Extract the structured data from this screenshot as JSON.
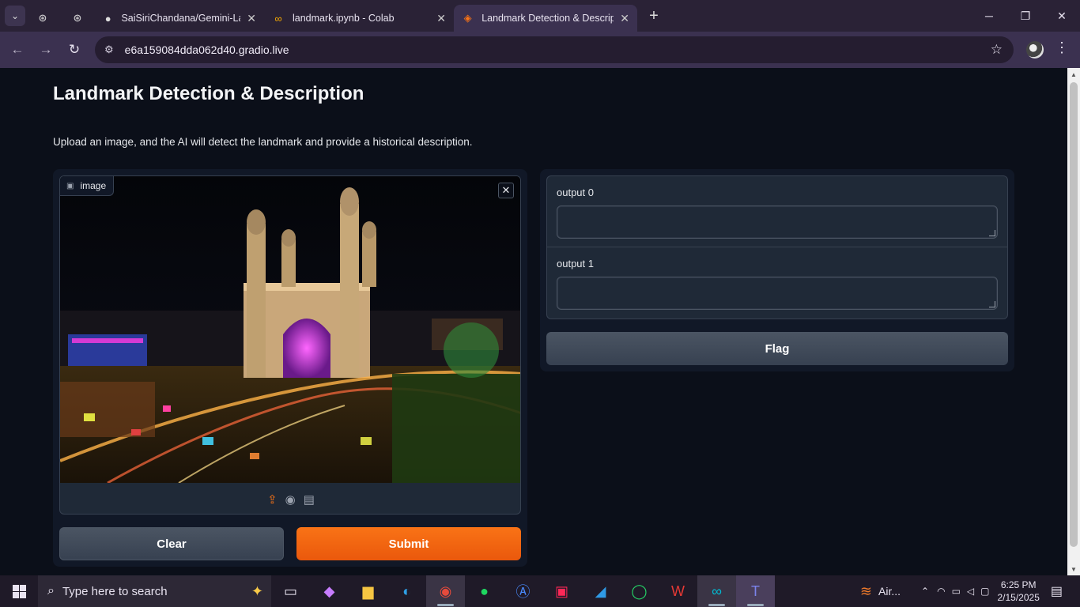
{
  "browser": {
    "tabs": [
      {
        "title": "",
        "icon": "chatgpt-icon",
        "pinned": true
      },
      {
        "title": "",
        "icon": "chatgpt-icon",
        "pinned": true
      },
      {
        "title": "SaiSiriChandana/Gemini-Landm",
        "icon": "github-icon"
      },
      {
        "title": "landmark.ipynb - Colab",
        "icon": "colab-icon"
      },
      {
        "title": "Landmark Detection & Descripti",
        "icon": "gradio-icon",
        "active": true
      }
    ],
    "url": "e6a159084dda062d40.gradio.live"
  },
  "page": {
    "title": "Landmark Detection & Description",
    "description": "Upload an image, and the AI will detect the landmark and provide a historical description.",
    "image_input": {
      "label": "image",
      "picture": "Charminar monument lit up at night above a busy market with light trails"
    },
    "buttons": {
      "clear": "Clear",
      "submit": "Submit",
      "flag": "Flag"
    },
    "outputs": [
      {
        "label": "output 0",
        "value": ""
      },
      {
        "label": "output 1",
        "value": ""
      }
    ]
  },
  "taskbar": {
    "search_placeholder": "Type here to search",
    "weather": "Air...",
    "time": "6:25 PM",
    "date": "2/15/2025"
  },
  "colors": {
    "accent": "#f97316",
    "page_bg": "#0b0f19",
    "panel_bg": "#111827",
    "block_bg": "#1f2937"
  }
}
